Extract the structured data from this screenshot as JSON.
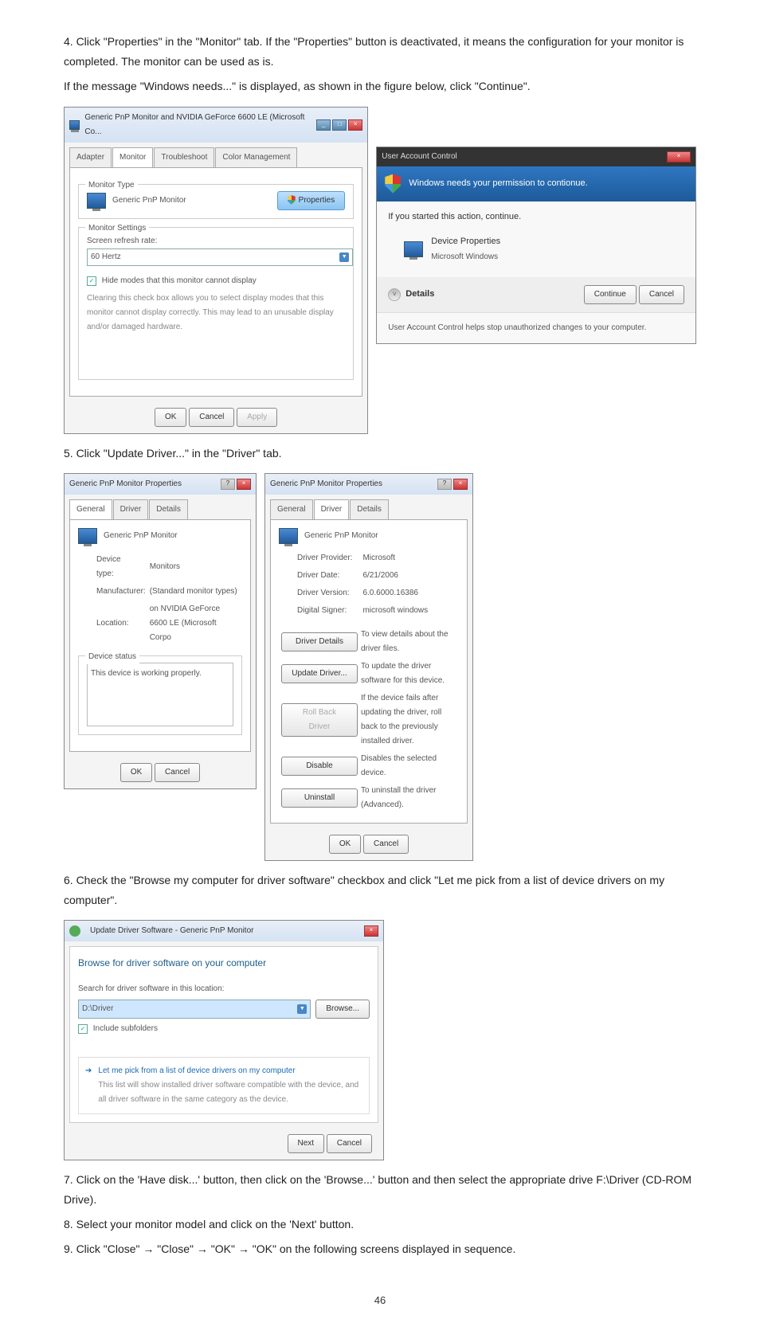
{
  "step4": {
    "text1": "4. Click \"Properties\" in the \"Monitor\" tab. If the \"Properties\" button is deactivated, it means the configuration for your monitor is completed. The monitor can be used as is.",
    "text2": "If the message \"Windows needs...\" is displayed, as shown in the figure below, click \"Continue\"."
  },
  "monitorDialog": {
    "title": "Generic PnP Monitor and NVIDIA GeForce 6600 LE (Microsoft Co...",
    "tabs": [
      "Adapter",
      "Monitor",
      "Troubleshoot",
      "Color Management"
    ],
    "monitorTypeLabel": "Monitor Type",
    "monitorName": "Generic PnP Monitor",
    "propertiesBtn": "Properties",
    "settingsLabel": "Monitor Settings",
    "refreshLabel": "Screen refresh rate:",
    "refreshValue": "60 Hertz",
    "hideModes": "Hide modes that this monitor cannot display",
    "hideModesDesc": "Clearing this check box allows you to select display modes that this monitor cannot display correctly. This may lead to an unusable display and/or damaged hardware.",
    "ok": "OK",
    "cancel": "Cancel",
    "apply": "Apply"
  },
  "uac": {
    "title": "User Account Control",
    "header": "Windows needs your permission to contionue.",
    "ifStarted": "If you started this action, continue.",
    "devProps": "Device Properties",
    "msWindows": "Microsoft Windows",
    "details": "Details",
    "continue": "Continue",
    "cancel": "Cancel",
    "footer": "User Account Control helps stop unauthorized changes to your computer."
  },
  "step5": {
    "text": "5. Click \"Update Driver...\" in the \"Driver\" tab."
  },
  "propGeneral": {
    "title": "Generic PnP Monitor Properties",
    "tabs": [
      "General",
      "Driver",
      "Details"
    ],
    "monitorName": "Generic PnP Monitor",
    "deviceTypeL": "Device type:",
    "deviceTypeV": "Monitors",
    "manufacturerL": "Manufacturer:",
    "manufacturerV": "(Standard monitor types)",
    "locationL": "Location:",
    "locationV": "on NVIDIA GeForce 6600 LE (Microsoft Corpo",
    "statusL": "Device status",
    "statusV": "This device is working properly.",
    "ok": "OK",
    "cancel": "Cancel"
  },
  "propDriver": {
    "title": "Generic PnP Monitor Properties",
    "tabs": [
      "General",
      "Driver",
      "Details"
    ],
    "monitorName": "Generic PnP Monitor",
    "providerL": "Driver Provider:",
    "providerV": "Microsoft",
    "dateL": "Driver Date:",
    "dateV": "6/21/2006",
    "versionL": "Driver Version:",
    "versionV": "6.0.6000.16386",
    "signerL": "Digital Signer:",
    "signerV": "microsoft windows",
    "btnDetails": "Driver Details",
    "btnDetailsDesc": "To view details about the driver files.",
    "btnUpdate": "Update Driver...",
    "btnUpdateDesc": "To update the driver software for this device.",
    "btnRollback": "Roll Back Driver",
    "btnRollbackDesc": "If the device fails after updating the driver, roll back to the previously installed driver.",
    "btnDisable": "Disable",
    "btnDisableDesc": "Disables the selected device.",
    "btnUninstall": "Uninstall",
    "btnUninstallDesc": "To uninstall the driver (Advanced).",
    "ok": "OK",
    "cancel": "Cancel"
  },
  "step6": {
    "text": "6. Check the \"Browse my computer for driver software\" checkbox and click \"Let me pick from a list of device drivers on my computer\"."
  },
  "browse": {
    "title": "Update Driver Software - Generic PnP Monitor",
    "heading": "Browse for driver software on your computer",
    "searchLabel": "Search for driver software in this location:",
    "path": "D:\\Driver",
    "browseBtn": "Browse...",
    "includeSub": "Include subfolders",
    "pickHeading": "Let me pick from a list of device drivers on my computer",
    "pickDesc": "This list will show installed driver software compatible with the device, and all driver software in the same category as the device.",
    "next": "Next",
    "cancel": "Cancel"
  },
  "step7": {
    "text": "7. Click on the 'Have disk...' button, then click on the 'Browse...' button and then select the appropriate drive F:\\Driver (CD-ROM Drive)."
  },
  "step8": {
    "text": "8. Select your monitor model and click on the 'Next' button."
  },
  "step9": {
    "text": "9. Click \"Close\"  →  \"Close\"  →  \"OK\"  →  \"OK\" on the following screens displayed in sequence."
  },
  "pageNum": "46"
}
